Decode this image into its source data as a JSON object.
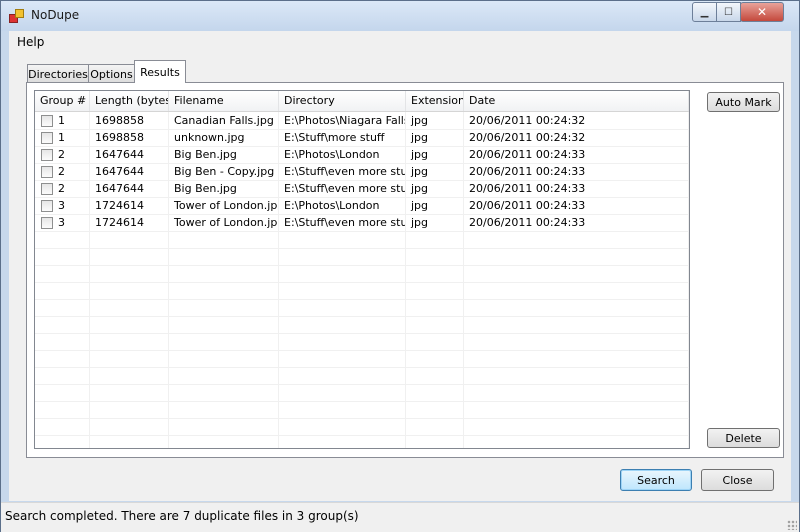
{
  "window": {
    "title": "NoDupe"
  },
  "menu": {
    "items": [
      "Help"
    ]
  },
  "tabs": [
    "Directories",
    "Options",
    "Results"
  ],
  "grid": {
    "columns": [
      "Group #",
      "Length (bytes)",
      "Filename",
      "Directory",
      "Extension",
      "Date"
    ],
    "rows": [
      {
        "group": "1",
        "length": "1698858",
        "filename": "Canadian Falls.jpg",
        "directory": "E:\\Photos\\Niagara Falls",
        "extension": "jpg",
        "date": "20/06/2011 00:24:32"
      },
      {
        "group": "1",
        "length": "1698858",
        "filename": "unknown.jpg",
        "directory": "E:\\Stuff\\more stuff",
        "extension": "jpg",
        "date": "20/06/2011 00:24:32"
      },
      {
        "group": "2",
        "length": "1647644",
        "filename": "Big Ben.jpg",
        "directory": "E:\\Photos\\London",
        "extension": "jpg",
        "date": "20/06/2011 00:24:33"
      },
      {
        "group": "2",
        "length": "1647644",
        "filename": "Big Ben - Copy.jpg",
        "directory": "E:\\Stuff\\even more stuff",
        "extension": "jpg",
        "date": "20/06/2011 00:24:33"
      },
      {
        "group": "2",
        "length": "1647644",
        "filename": "Big Ben.jpg",
        "directory": "E:\\Stuff\\even more stuff",
        "extension": "jpg",
        "date": "20/06/2011 00:24:33"
      },
      {
        "group": "3",
        "length": "1724614",
        "filename": "Tower of London.jpg",
        "directory": "E:\\Photos\\London",
        "extension": "jpg",
        "date": "20/06/2011 00:24:33"
      },
      {
        "group": "3",
        "length": "1724614",
        "filename": "Tower of London.jpg",
        "directory": "E:\\Stuff\\even more stuff",
        "extension": "jpg",
        "date": "20/06/2011 00:24:33"
      }
    ]
  },
  "buttons": {
    "auto_mark": "Auto Mark",
    "delete": "Delete",
    "search": "Search",
    "close": "Close"
  },
  "status": {
    "text": "Search completed. There are 7 duplicate files in 3 group(s)"
  },
  "icons": {
    "app": "app-icon",
    "minimize": "minimize-icon",
    "maximize": "maximize-icon",
    "close": "close-icon"
  },
  "colors": {
    "search_button_accent": "#3c7fb1",
    "close_caption": "#c4493c"
  }
}
